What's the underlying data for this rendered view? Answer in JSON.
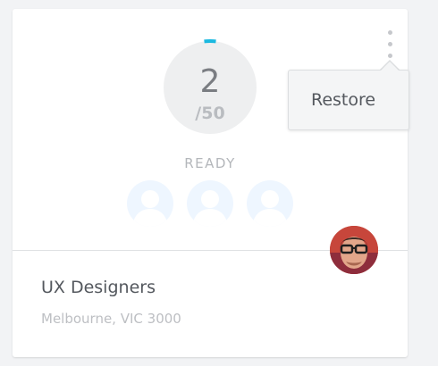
{
  "card": {
    "count": "2",
    "total": "/50",
    "progress": 0.04,
    "status": "READY",
    "title": "UX Designers",
    "location": "Melbourne, VIC 3000",
    "accent_color": "#1bb9e0",
    "placeholder_count": 3
  },
  "menu": {
    "items": [
      {
        "label": "Restore"
      }
    ]
  },
  "icons": {
    "more": "kebab-vertical-icon",
    "placeholder": "user-placeholder-icon"
  }
}
